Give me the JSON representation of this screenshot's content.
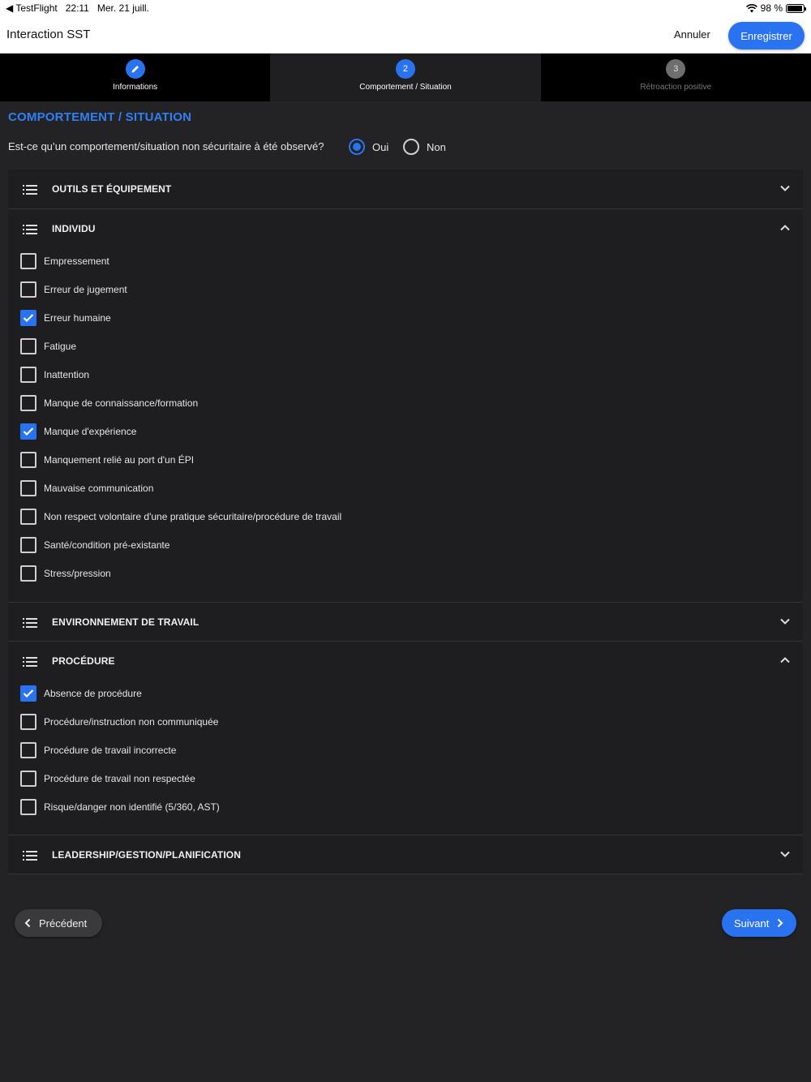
{
  "status_bar": {
    "back_app": "TestFlight",
    "time": "22:11",
    "date": "Mer. 21 juill.",
    "battery": "98 %"
  },
  "app_bar": {
    "title": "Interaction SST",
    "cancel_label": "Annuler",
    "save_label": "Enregistrer"
  },
  "stepper": [
    {
      "number": "",
      "label": "Informations",
      "state": "done"
    },
    {
      "number": "2",
      "label": "Comportement / Situation",
      "state": "active"
    },
    {
      "number": "3",
      "label": "Rétroaction positive",
      "state": "inactive"
    }
  ],
  "section_title": "COMPORTEMENT / SITUATION",
  "question": {
    "text": "Est-ce qu’un comportement/situation non sécuritaire à été observé?",
    "yes_label": "Oui",
    "no_label": "Non",
    "selected": "Oui"
  },
  "panels": [
    {
      "title": "OUTILS ET ÉQUIPEMENT",
      "expanded": false,
      "items": []
    },
    {
      "title": "INDIVIDU",
      "expanded": true,
      "items": [
        {
          "label": "Empressement",
          "checked": false
        },
        {
          "label": "Erreur de jugement",
          "checked": false
        },
        {
          "label": "Erreur humaine",
          "checked": true
        },
        {
          "label": "Fatigue",
          "checked": false
        },
        {
          "label": "Inattention",
          "checked": false
        },
        {
          "label": "Manque de connaissance/formation",
          "checked": false
        },
        {
          "label": "Manque d'expérience",
          "checked": true
        },
        {
          "label": "Manquement relié au port d'un ÉPI",
          "checked": false
        },
        {
          "label": "Mauvaise communication",
          "checked": false
        },
        {
          "label": "Non respect volontaire d'une pratique sécuritaire/procédure de travail",
          "checked": false
        },
        {
          "label": "Santé/condition pré-existante",
          "checked": false
        },
        {
          "label": "Stress/pression",
          "checked": false
        }
      ]
    },
    {
      "title": "ENVIRONNEMENT DE TRAVAIL",
      "expanded": false,
      "items": []
    },
    {
      "title": "PROCÉDURE",
      "expanded": true,
      "items": [
        {
          "label": "Absence de procédure",
          "checked": true
        },
        {
          "label": "Procédure/instruction non communiquée",
          "checked": false
        },
        {
          "label": "Procédure de travail incorrecte",
          "checked": false
        },
        {
          "label": "Procédure de travail non respectée",
          "checked": false
        },
        {
          "label": "Risque/danger non identifié (5/360, AST)",
          "checked": false
        }
      ]
    },
    {
      "title": "LEADERSHIP/GESTION/PLANIFICATION",
      "expanded": false,
      "items": []
    }
  ],
  "nav": {
    "prev_label": "Précédent",
    "next_label": "Suivant"
  },
  "colors": {
    "accent": "#2a73f0",
    "background": "#232325",
    "panel": "#1e1e20"
  },
  "icons": {
    "step_done": "pencil-icon",
    "panel": "list-icon",
    "collapsed": "chevron-down-icon",
    "expanded": "chevron-up-icon"
  }
}
